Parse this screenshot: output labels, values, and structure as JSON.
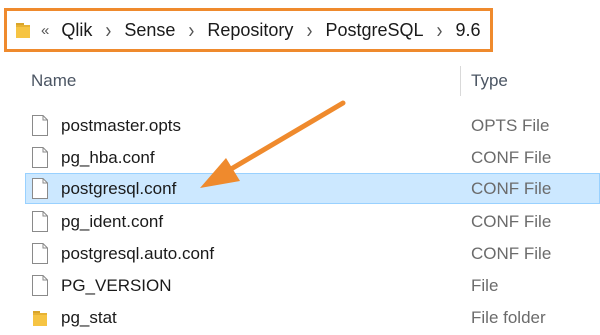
{
  "address_bar": {
    "overflow_chevrons": "«",
    "crumbs": [
      "Qlik",
      "Sense",
      "Repository",
      "PostgreSQL",
      "9.6"
    ],
    "separator": "›"
  },
  "columns": {
    "name": "Name",
    "type": "Type"
  },
  "files": [
    {
      "name": "postmaster.opts",
      "type": "OPTS File",
      "icon": "file-icon"
    },
    {
      "name": "pg_hba.conf",
      "type": "CONF File",
      "icon": "file-icon"
    },
    {
      "name": "postgresql.conf",
      "type": "CONF File",
      "icon": "file-icon",
      "selected": true
    },
    {
      "name": "pg_ident.conf",
      "type": "CONF File",
      "icon": "file-icon"
    },
    {
      "name": "postgresql.auto.conf",
      "type": "CONF File",
      "icon": "file-icon"
    },
    {
      "name": "PG_VERSION",
      "type": "File",
      "icon": "file-icon"
    },
    {
      "name": "pg_stat",
      "type": "File folder",
      "icon": "folder-icon"
    }
  ],
  "colors": {
    "highlight": "#ef8a2d",
    "selection": "#cce8ff",
    "selection_border": "#99d1ff"
  }
}
